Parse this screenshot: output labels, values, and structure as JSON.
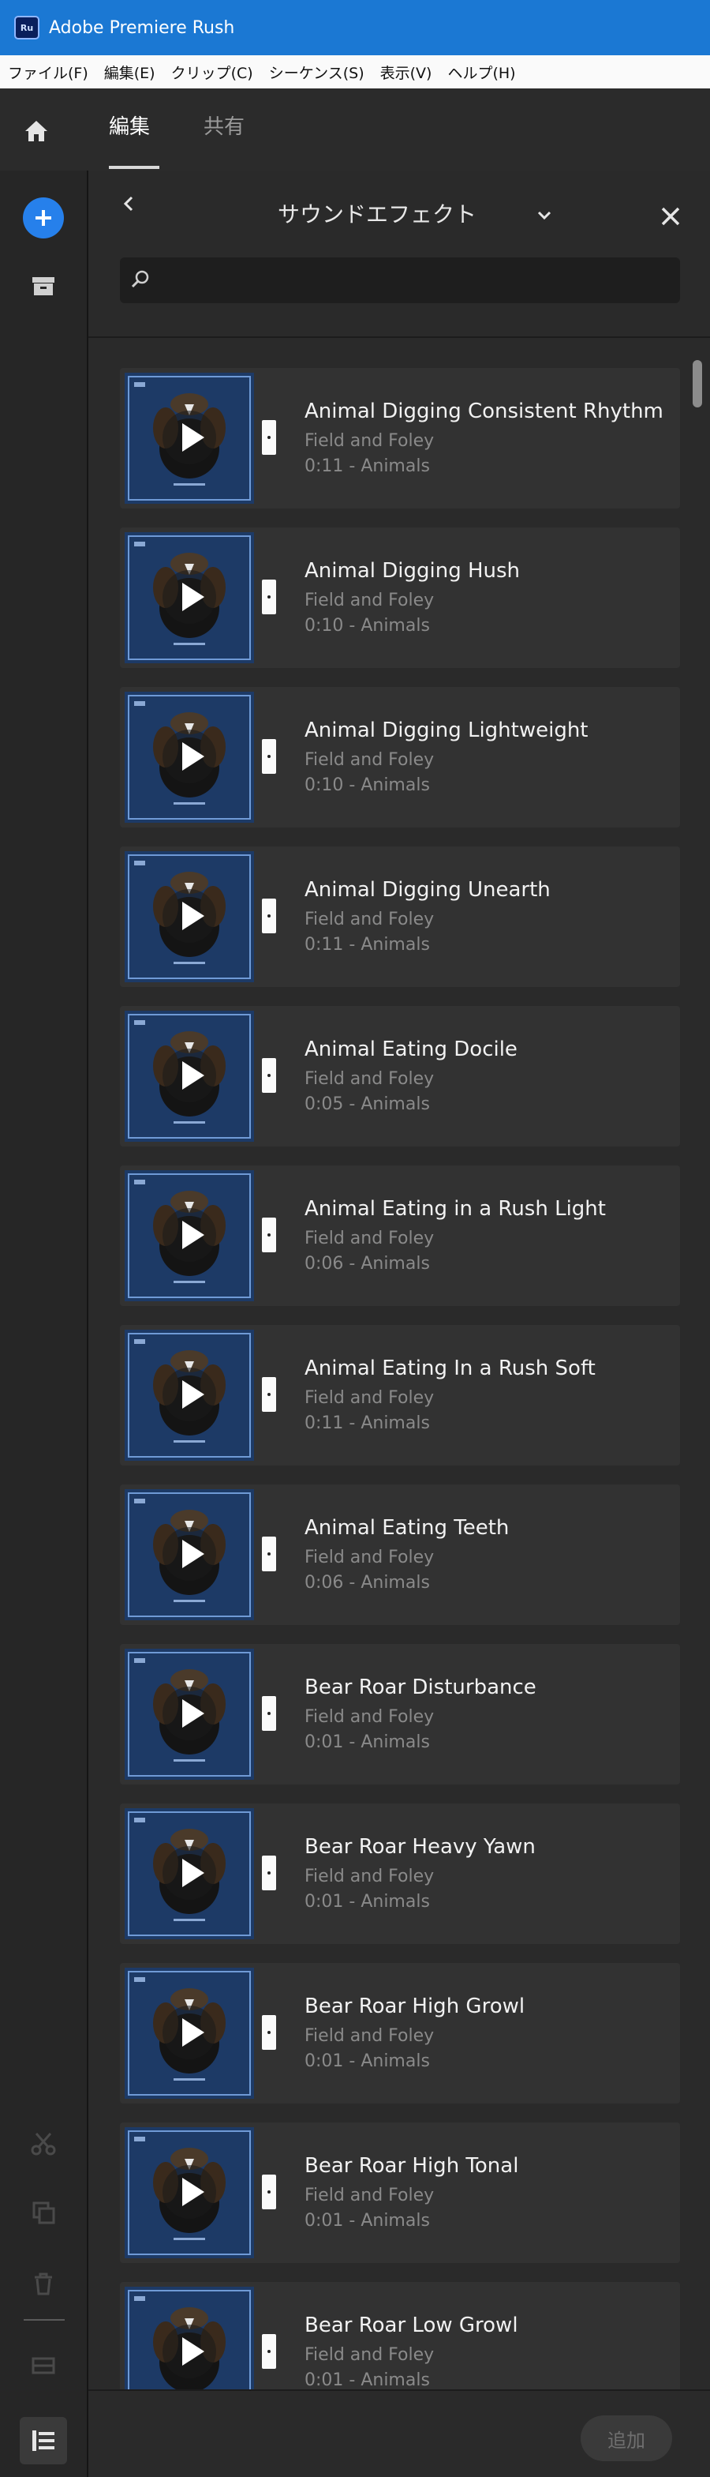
{
  "window": {
    "app_icon_label": "Ru",
    "title": "Adobe Premiere Rush"
  },
  "menubar": {
    "items": [
      "ファイル(F)",
      "編集(E)",
      "クリップ(C)",
      "シーケンス(S)",
      "表示(V)",
      "ヘルプ(H)"
    ]
  },
  "appbar": {
    "tabs": [
      {
        "label": "編集",
        "active": true
      },
      {
        "label": "共有",
        "active": false
      }
    ]
  },
  "panel": {
    "title": "サウンドエフェクト",
    "search": {
      "value": "",
      "placeholder": ""
    },
    "add_label": "追加"
  },
  "effects": [
    {
      "title": "Animal Digging Consistent Rhythm",
      "source": "Field and Foley",
      "meta": "0:11 - Animals"
    },
    {
      "title": "Animal Digging Hush",
      "source": "Field and Foley",
      "meta": "0:10 - Animals"
    },
    {
      "title": "Animal Digging Lightweight",
      "source": "Field and Foley",
      "meta": "0:10 - Animals"
    },
    {
      "title": "Animal Digging Unearth",
      "source": "Field and Foley",
      "meta": "0:11 - Animals"
    },
    {
      "title": "Animal Eating Docile",
      "source": "Field and Foley",
      "meta": "0:05 - Animals"
    },
    {
      "title": "Animal Eating in a Rush Light",
      "source": "Field and Foley",
      "meta": "0:06 - Animals"
    },
    {
      "title": "Animal Eating In a Rush Soft",
      "source": "Field and Foley",
      "meta": "0:11 - Animals"
    },
    {
      "title": "Animal Eating Teeth",
      "source": "Field and Foley",
      "meta": "0:06 - Animals"
    },
    {
      "title": "Bear Roar Disturbance",
      "source": "Field and Foley",
      "meta": "0:01 - Animals"
    },
    {
      "title": "Bear Roar Heavy Yawn",
      "source": "Field and Foley",
      "meta": "0:01 - Animals"
    },
    {
      "title": "Bear Roar High Growl",
      "source": "Field and Foley",
      "meta": "0:01 - Animals"
    },
    {
      "title": "Bear Roar High Tonal",
      "source": "Field and Foley",
      "meta": "0:01 - Animals"
    },
    {
      "title": "Bear Roar Low Growl",
      "source": "Field and Foley",
      "meta": "0:01 - Animals"
    }
  ],
  "colors": {
    "titlebar": "#1b78d3",
    "accent": "#2680eb",
    "thumb_bg": "#1d3a66"
  }
}
